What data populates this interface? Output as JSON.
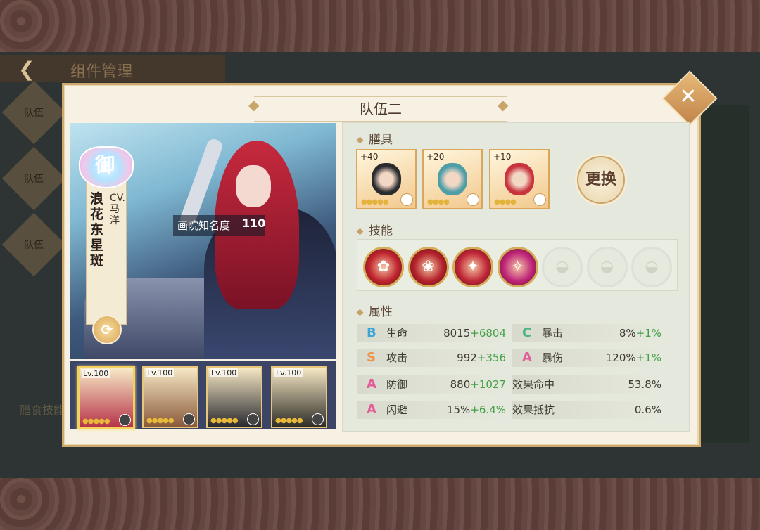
{
  "background": {
    "back_title": "组件管理",
    "side_tabs": [
      "队伍",
      "队伍",
      "队伍"
    ],
    "left_bottom": "膳食技能"
  },
  "dialog": {
    "title": "队伍二",
    "close_icon": "close-icon"
  },
  "character": {
    "rank": "御",
    "name": "浪花东星斑",
    "cv": "CV.马洋",
    "fame_label": "画院知名度",
    "fame_value": "110",
    "swap_icon": "swap-icon"
  },
  "team": [
    {
      "level": "Lv.100",
      "stars": "●●●●●",
      "selected": true,
      "color": "#b63247"
    },
    {
      "level": "Lv.100",
      "stars": "●●●●●",
      "selected": false,
      "color": "#8a5a3a"
    },
    {
      "level": "Lv.100",
      "stars": "●●●●●",
      "selected": false,
      "color": "#2a2a30"
    },
    {
      "level": "Lv.100",
      "stars": "●●●●●",
      "selected": false,
      "color": "#2f2c27"
    }
  ],
  "dishes": {
    "heading": "膳具",
    "items": [
      {
        "plus": "+40",
        "stars": "●●●●●",
        "color": "#2a2b2f"
      },
      {
        "plus": "+20",
        "stars": "●●●●",
        "color": "#4d9ea7"
      },
      {
        "plus": "+10",
        "stars": "●●●●",
        "color": "#c8333c"
      }
    ],
    "change_button": "更换"
  },
  "skills": {
    "heading": "技能",
    "items": [
      {
        "locked": false,
        "color": "#c0242f",
        "glyph": "✿"
      },
      {
        "locked": false,
        "color": "#b4222c",
        "glyph": "❀"
      },
      {
        "locked": false,
        "color": "#c02738",
        "glyph": "✦"
      },
      {
        "locked": false,
        "color": "#c0267a",
        "glyph": "✧"
      },
      {
        "locked": true,
        "color": "#e6e9de",
        "glyph": "◒"
      },
      {
        "locked": true,
        "color": "#e6e9de",
        "glyph": "◒"
      },
      {
        "locked": true,
        "color": "#e6e9de",
        "glyph": "◒"
      }
    ]
  },
  "attributes": {
    "heading": "属性",
    "grade_colors": {
      "B": "#3aa7d8",
      "C": "#49b487",
      "S": "#f0924a",
      "A": "#e35c9a"
    },
    "left": [
      {
        "grade": "B",
        "name": "生命",
        "base": "8015",
        "bonus": "+6804"
      },
      {
        "grade": "S",
        "name": "攻击",
        "base": "992",
        "bonus": "+356"
      },
      {
        "grade": "A",
        "name": "防御",
        "base": "880",
        "bonus": "+1027"
      },
      {
        "grade": "A",
        "name": "闪避",
        "base": "15%",
        "bonus": "+6.4%"
      }
    ],
    "right": [
      {
        "grade": "C",
        "name": "暴击",
        "base": "8%",
        "bonus": "+1%"
      },
      {
        "grade": "A",
        "name": "暴伤",
        "base": "120%",
        "bonus": "+1%"
      },
      {
        "grade": "",
        "name": "效果命中",
        "base": "53.8%",
        "bonus": ""
      },
      {
        "grade": "",
        "name": "效果抵抗",
        "base": "0.6%",
        "bonus": ""
      }
    ]
  }
}
